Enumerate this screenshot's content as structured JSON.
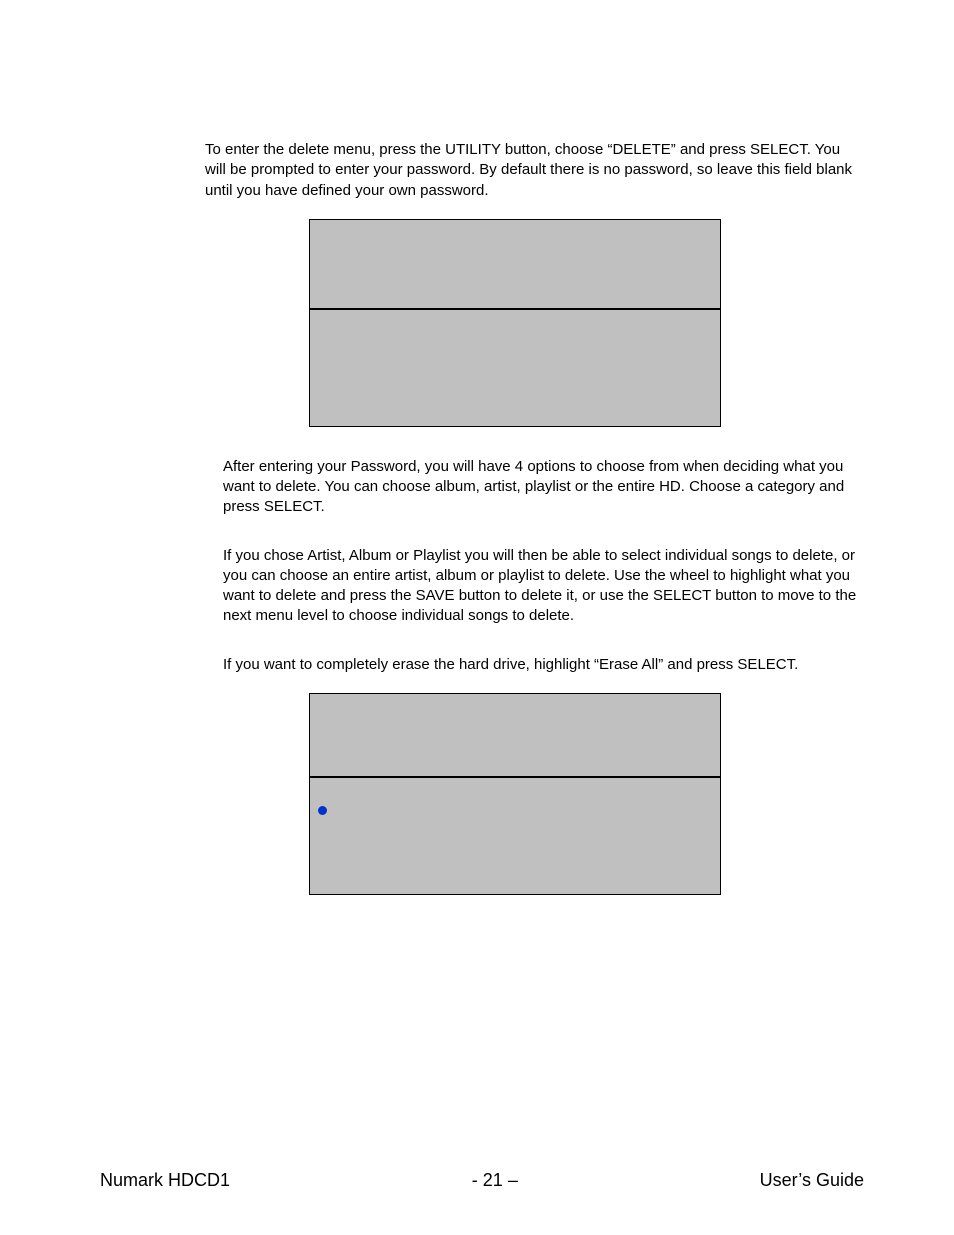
{
  "paragraphs": {
    "p1": "To enter the delete menu, press the UTILITY button, choose “DELETE” and press SELECT.  You will be prompted to enter your password.  By default there is no password, so leave this field blank until you have defined your own password.",
    "p2": "After entering your Password, you will have 4 options to choose from when deciding what you want to delete.  You can choose album, artist, playlist or the entire HD.  Choose a category and press SELECT.",
    "p3": "If you chose Artist, Album or Playlist you will then be able to select individual songs to delete, or you can choose an entire artist, album or playlist to delete.  Use the wheel to highlight what you want to delete and press the SAVE button to delete it, or use the SELECT button to move to the next menu level to choose individual songs to delete.",
    "p4": "If you want to completely erase the hard drive, highlight “Erase All” and press SELECT."
  },
  "footer": {
    "left": "Numark HDCD1",
    "center": "- 21 –",
    "right": "User’s Guide"
  }
}
